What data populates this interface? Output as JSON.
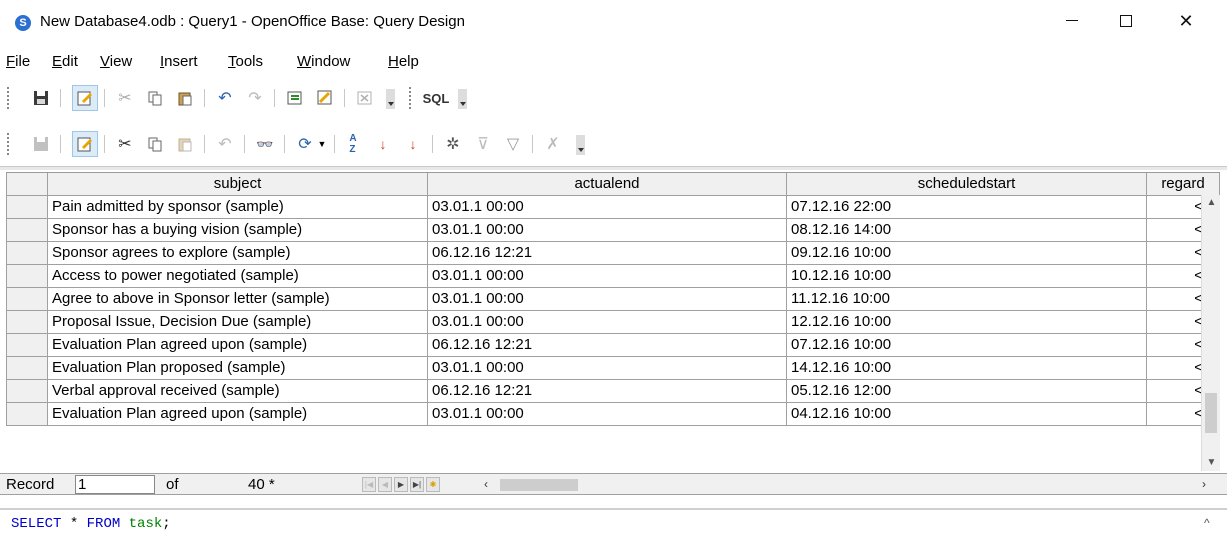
{
  "window": {
    "title": "New Database4.odb : Query1 - OpenOffice Base: Query Design",
    "minimize_label": "—",
    "close_label": "✕"
  },
  "menu": [
    {
      "label": "File",
      "u": "F",
      "rest": "ile"
    },
    {
      "label": "Edit",
      "u": "E",
      "rest": "dit"
    },
    {
      "label": "View",
      "u": "V",
      "rest": "iew"
    },
    {
      "label": "Insert",
      "u": "I",
      "rest": "nsert"
    },
    {
      "label": "Tools",
      "u": "T",
      "rest": "ools"
    },
    {
      "label": "Window",
      "u": "W",
      "rest": "indow"
    },
    {
      "label": "Help",
      "u": "H",
      "rest": "elp"
    }
  ],
  "toolbar1": {
    "sql_label": "SQL"
  },
  "grid": {
    "columns": [
      "subject",
      "actualend",
      "scheduledstart",
      "regard"
    ],
    "rows": [
      [
        "Pain admitted by sponsor (sample)",
        "03.01.1 00:00",
        "07.12.16 22:00",
        "<"
      ],
      [
        "Sponsor has a buying vision (sample)",
        "03.01.1 00:00",
        "08.12.16 14:00",
        "<"
      ],
      [
        "Sponsor agrees to explore (sample)",
        "06.12.16 12:21",
        "09.12.16 10:00",
        "<"
      ],
      [
        "Access to power negotiated (sample)",
        "03.01.1 00:00",
        "10.12.16 10:00",
        "<"
      ],
      [
        "Agree to above in Sponsor letter (sample)",
        "03.01.1 00:00",
        "11.12.16 10:00",
        "<"
      ],
      [
        "Proposal Issue, Decision Due (sample)",
        "03.01.1 00:00",
        "12.12.16 10:00",
        "<"
      ],
      [
        "Evaluation Plan agreed upon (sample)",
        "06.12.16 12:21",
        "07.12.16 10:00",
        "<"
      ],
      [
        "Evaluation Plan proposed (sample)",
        "03.01.1 00:00",
        "14.12.16 10:00",
        "<"
      ],
      [
        "Verbal approval received (sample)",
        "06.12.16 12:21",
        "05.12.16 12:00",
        "<"
      ],
      [
        "Evaluation Plan agreed upon (sample)",
        "03.01.1 00:00",
        "04.12.16 10:00",
        "<"
      ]
    ]
  },
  "record_bar": {
    "label": "Record",
    "current": "1",
    "of_label": "of",
    "count": "40 *"
  },
  "sql": {
    "kw1": "SELECT",
    "star": " * ",
    "kw2": "FROM",
    "table": "task",
    "end": ";"
  }
}
